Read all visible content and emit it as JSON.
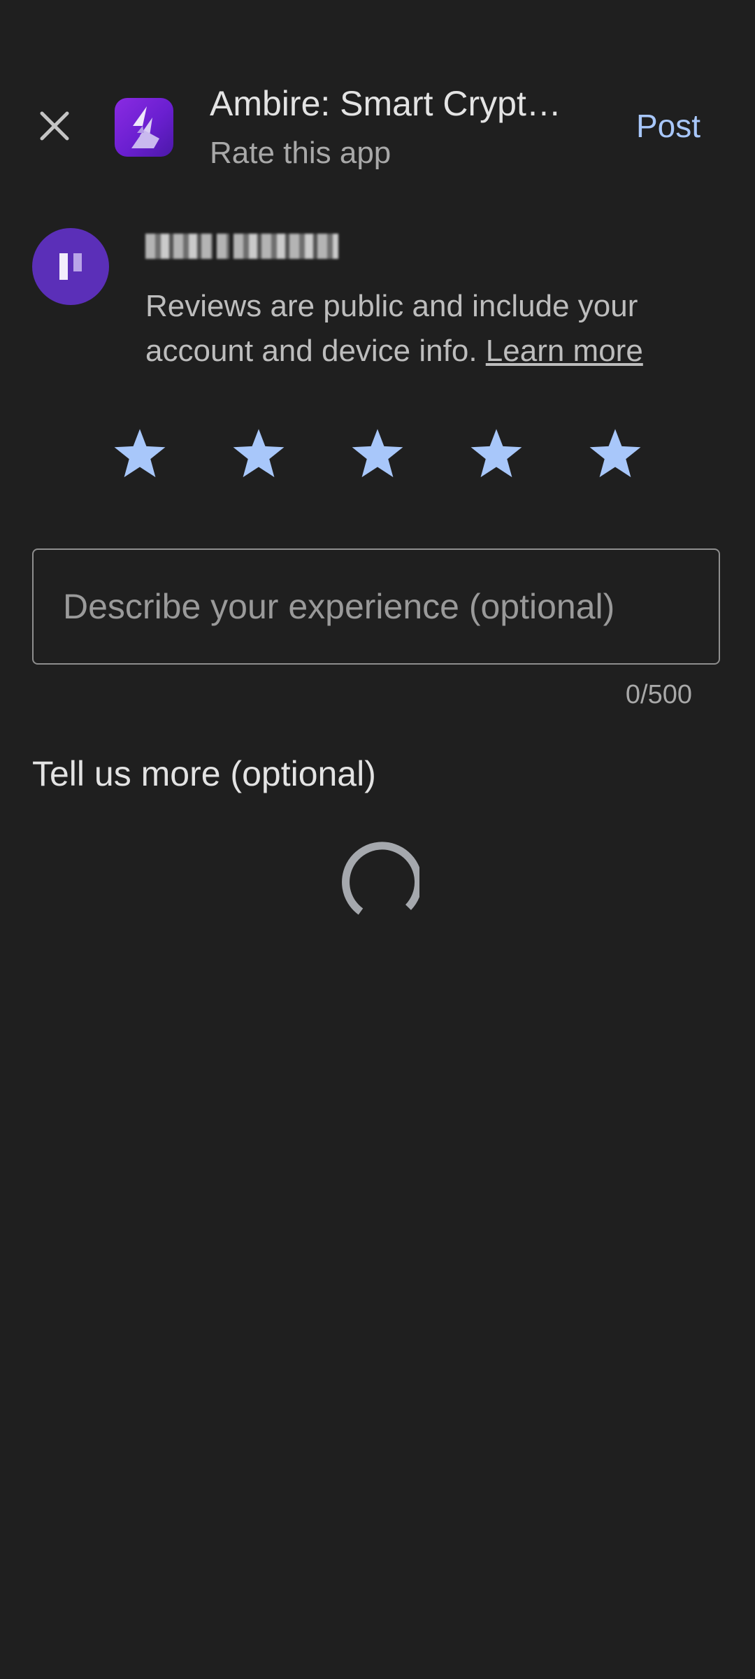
{
  "header": {
    "close_icon": "close-icon",
    "app_title": "Ambire: Smart Crypt…",
    "subtitle": "Rate this app",
    "post_label": "Post",
    "accent_color": "#a8c7fa"
  },
  "user": {
    "avatar_color": "#5b2fb8",
    "notice_text": "Reviews are public and include your account and device info.",
    "learn_more": "Learn more"
  },
  "rating": {
    "stars_filled": 5,
    "stars_total": 5,
    "star_color": "#a8c7fa",
    "star_icon": "star-icon"
  },
  "review": {
    "placeholder": "Describe your experience (optional)",
    "value": "",
    "counter": "0/500"
  },
  "more": {
    "title": "Tell us more (optional)",
    "loading_icon": "loading-spinner-icon"
  }
}
